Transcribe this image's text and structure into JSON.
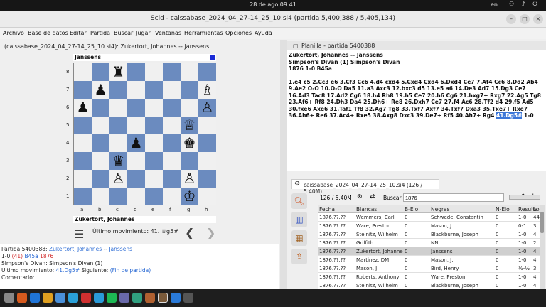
{
  "topbar": {
    "clock": "28 de ago  09:41",
    "lang": "en",
    "icons": "⚇ ♪ ⏻"
  },
  "window": {
    "title": "Scid - caissabase_2024_04_27-14_25_10.si4 (partida 5,400,388 / 5,405,134)",
    "min": "–",
    "max": "□",
    "close": "×"
  },
  "menu": [
    "Archivo",
    "Base de datos",
    "Editar",
    "Partida",
    "Buscar",
    "Jugar",
    "Ventanas",
    "Herramientas",
    "Opciones",
    "Ayuda"
  ],
  "left_title": "(caissabase_2024_04_27-14_25_10.si4): Zukertort, Johannes -- Janssens",
  "board": {
    "top_name": "Janssens",
    "bottom_name": "Zukertort, Johannes",
    "ranks": [
      "8",
      "7",
      "6",
      "5",
      "4",
      "3",
      "2",
      "1"
    ],
    "files": [
      "a",
      "b",
      "c",
      "d",
      "e",
      "f",
      "g",
      "h"
    ],
    "pieces": [
      {
        "sq": "c8",
        "g": "♜"
      },
      {
        "sq": "b7",
        "g": "♟"
      },
      {
        "sq": "h7",
        "g": "♗"
      },
      {
        "sq": "a6",
        "g": "♟"
      },
      {
        "sq": "h6",
        "g": "♙"
      },
      {
        "sq": "g5",
        "g": "♕"
      },
      {
        "sq": "d4",
        "g": "♟"
      },
      {
        "sq": "g4",
        "g": "♚"
      },
      {
        "sq": "c3",
        "g": "♛"
      },
      {
        "sq": "c2",
        "g": "♙"
      },
      {
        "sq": "g2",
        "g": "♙"
      },
      {
        "sq": "g1",
        "g": "♔"
      }
    ]
  },
  "nav": {
    "last_move_label": "Último movimiento: 41. ♕g5#",
    "prev": "❮",
    "next": "❯",
    "menu": "☰"
  },
  "info": {
    "line1_prefix": "Partida 5400388:",
    "white": "Zukertort, Johannes",
    "sep": "--",
    "black": "Janssens",
    "result": "1-0",
    "moves": "(41)",
    "eco": "B45a",
    "year": "1876",
    "event": "Simpson's Divan:  Simpson's Divan (1)",
    "last_label": "Ultimo movimiento:",
    "last_move": "41.Dg5#",
    "next_label": "Siguiente:",
    "next_val": "(Fin de partida)",
    "comment": "Comentario:"
  },
  "planilla": {
    "title": "Planilla - partida 5400388",
    "h1": "Zukertort, Johannes   --   Janssens",
    "h2": "Simpson's Divan (1)  Simpson's Divan",
    "h3": "1876  1-0  B45a",
    "moves": "1.e4 c5 2.Cc3 e6 3.Cf3 Cc6 4.d4 cxd4 5.Cxd4 Cxd4 6.Dxd4 Ce7 7.Af4 Cc6 8.Dd2 Ab4 9.Ae2 O-O 10.O-O Da5 11.a3 Axc3 12.bxc3 d5 13.e5 a6 14.De3 Ad7 15.Dg3 Ce7 16.Ad3 Tac8 17.Ad2 Cg6 18.h4 Rh8 19.h5 Ce7 20.h6 Cg6 21.hxg7+ Rxg7 22.Ag5 Tg8 23.Af6+ Rf8 24.Dh3 Da4 25.Dh6+ Re8 26.Dxh7 Ce7 27.f4 Ac6 28.Tf2 d4 29.f5 Ad5 30.fxe6 Axe6 31.Taf1 Tf8 32.Ag7 Tg8 33.Txf7 Axf7 34.Txf7 Dxa3 35.Txe7+ Rxe7 36.Ah6+ Re6 37.Ac4+ Rxe5 38.Axg8 Dxc3 39.De7+ Rf5 40.Ah7+ Rg4",
    "last": "41.Dg5#",
    "result": "1-0"
  },
  "dbtab": {
    "title": "caissabase_2024_04_27-14_25_10.si4 (126 / 5.40M)"
  },
  "search": {
    "count": "126 / 5.40M",
    "label": "Buscar",
    "value": "1876"
  },
  "table": {
    "headers": [
      "Fecha",
      "Blancas",
      "B-Elo",
      "Negras",
      "N-Elo",
      "Resulta",
      "Lo"
    ],
    "rows": [
      [
        "1876.??.??",
        "Wemmers, Carl",
        "0",
        "Schwede, Constantin",
        "0",
        "1-0",
        "44"
      ],
      [
        "1876.??.??",
        "Ware, Preston",
        "0",
        "Mason, J.",
        "0",
        "0-1",
        "3"
      ],
      [
        "1876.??.??",
        "Steinitz, Wilhelm",
        "0",
        "Blackburne, Joseph",
        "0",
        "1-0",
        "4"
      ],
      [
        "1876.??.??",
        "Griffith",
        "0",
        "NN",
        "0",
        "1-0",
        "2"
      ],
      [
        "1876.??.??",
        "Zukertort, Johanne",
        "0",
        "Janssens",
        "0",
        "1-0",
        "4"
      ],
      [
        "1876.??.??",
        "Martinez, DM.",
        "0",
        "Mason, J.",
        "0",
        "1-0",
        "4"
      ],
      [
        "1876.??.??",
        "Mason, J.",
        "0",
        "Bird, Henry",
        "0",
        "½-½",
        "3"
      ],
      [
        "1876.??.??",
        "Roberts, Anthony",
        "0",
        "Ware, Preston",
        "0",
        "1-0",
        "4"
      ],
      [
        "1876.??.??",
        "Steinitz, Wilhelm",
        "0",
        "Blackburne, Joseph",
        "0",
        "1-0",
        "4"
      ]
    ]
  }
}
